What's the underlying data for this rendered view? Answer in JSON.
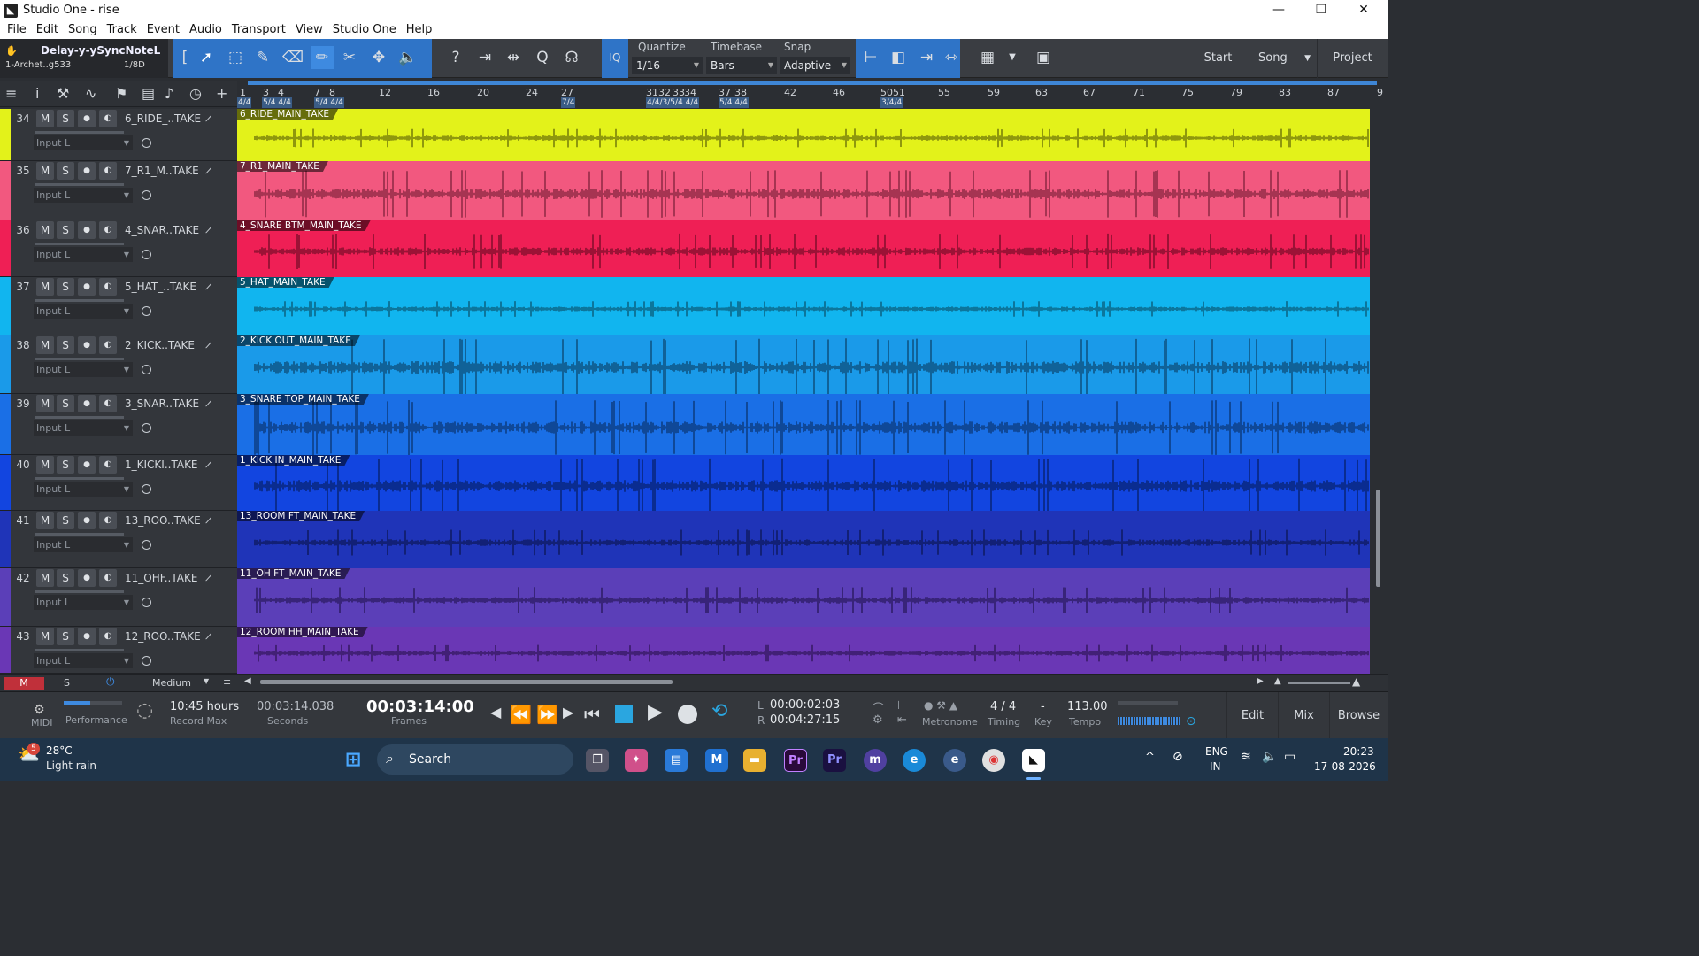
{
  "window": {
    "title": "Studio One - rise",
    "minimize": "—",
    "maximize": "❐",
    "close": "✕"
  },
  "menu": [
    "File",
    "Edit",
    "Song",
    "Track",
    "Event",
    "Audio",
    "Transport",
    "View",
    "Studio One",
    "Help"
  ],
  "instrument": {
    "name": "Delay-y-ySyncNoteL",
    "preset": "1-Archet..g533",
    "value": "1/8D"
  },
  "quantize": {
    "label": "Quantize",
    "value": "1/16"
  },
  "timebase": {
    "label": "Timebase",
    "value": "Bars"
  },
  "snap": {
    "label": "Snap",
    "value": "Adaptive"
  },
  "iq_label": "IQ",
  "right_buttons": {
    "start": "Start",
    "song": "Song",
    "project": "Project"
  },
  "ruler": {
    "bars": [
      "1",
      "3",
      "4",
      "7",
      "8",
      "12",
      "16",
      "20",
      "24",
      "27",
      "3132",
      "33",
      "34",
      "37",
      "38",
      "42",
      "46",
      "5051",
      "55",
      "59",
      "63",
      "67",
      "71",
      "75",
      "79",
      "83",
      "87",
      "9"
    ],
    "signatures": [
      "4/4",
      "5/4 4/4",
      "5/4 4/4",
      "7/4",
      "4/4/3/5/4 4/4",
      "5/4 4/4",
      "3/4/4"
    ]
  },
  "tracks": [
    {
      "num": "34",
      "name": "6_RIDE_..TAKE",
      "clip": "6_RIDE_MAIN_TAKE",
      "input": "Input L",
      "color": "#e3f21a",
      "wave": "#3b3e00"
    },
    {
      "num": "35",
      "name": "7_R1_M..TAKE",
      "clip": "7_R1_MAIN_TAKE",
      "input": "Input L",
      "color": "#f2587f",
      "wave": "#5a1025"
    },
    {
      "num": "36",
      "name": "4_SNAR..TAKE",
      "clip": "4_SNARE BTM_MAIN_TAKE",
      "input": "Input L",
      "color": "#ef1f55",
      "wave": "#4a0516"
    },
    {
      "num": "37",
      "name": "5_HAT_..TAKE",
      "clip": "5_HAT_MAIN_TAKE",
      "input": "Input L",
      "color": "#11b5ef",
      "wave": "#07374a"
    },
    {
      "num": "38",
      "name": "2_KICK..TAKE",
      "clip": "2_KICK OUT_MAIN_TAKE",
      "input": "Input L",
      "color": "#1a9ae9",
      "wave": "#052a46"
    },
    {
      "num": "39",
      "name": "3_SNAR..TAKE",
      "clip": "3_SNARE TOP_MAIN_TAKE",
      "input": "Input L",
      "color": "#1a6fe6",
      "wave": "#04204a"
    },
    {
      "num": "40",
      "name": "1_KICKI..TAKE",
      "clip": "1_KICK IN_MAIN_TAKE",
      "input": "Input L",
      "color": "#1245e0",
      "wave": "#03123f"
    },
    {
      "num": "41",
      "name": "13_ROO..TAKE",
      "clip": "13_ROOM FT_MAIN_TAKE",
      "input": "Input L",
      "color": "#1f34b8",
      "wave": "#050c33"
    },
    {
      "num": "42",
      "name": "11_OHF..TAKE",
      "clip": "11_OH FT_MAIN_TAKE",
      "input": "Input L",
      "color": "#5b3fb8",
      "wave": "#160a3a"
    },
    {
      "num": "43",
      "name": "12_ROO..TAKE",
      "clip": "12_ROOM HH_MAIN_TAKE",
      "input": "Input L",
      "color": "#6a37b5",
      "wave": "#1a0a38"
    }
  ],
  "track_buttons": {
    "mute": "M",
    "solo": "S"
  },
  "bottom": {
    "m": "M",
    "s": "S",
    "zoom": "Medium"
  },
  "transport": {
    "midi": "MIDI",
    "performance": "Performance",
    "record_hours": "10:45 hours",
    "record_max": "Record Max",
    "seconds_val": "00:03:14.038",
    "seconds_label": "Seconds",
    "frames_val": "00:03:14:00",
    "frames_label": "Frames",
    "l_val": "00:00:02:03",
    "r_val": "00:04:27:15",
    "l": "L",
    "r": "R",
    "metronome": "Metronome",
    "timing_val": "4 / 4",
    "timing": "Timing",
    "key_val": "-",
    "key": "Key",
    "tempo_val": "113.00",
    "tempo": "Tempo",
    "edit": "Edit",
    "mix": "Mix",
    "browse": "Browse"
  },
  "taskbar": {
    "temp": "28°C",
    "weather": "Light rain",
    "badge": "5",
    "search": "Search",
    "lang1": "ENG",
    "lang2": "IN",
    "time": "20:23",
    "date": "17-08-2026"
  }
}
